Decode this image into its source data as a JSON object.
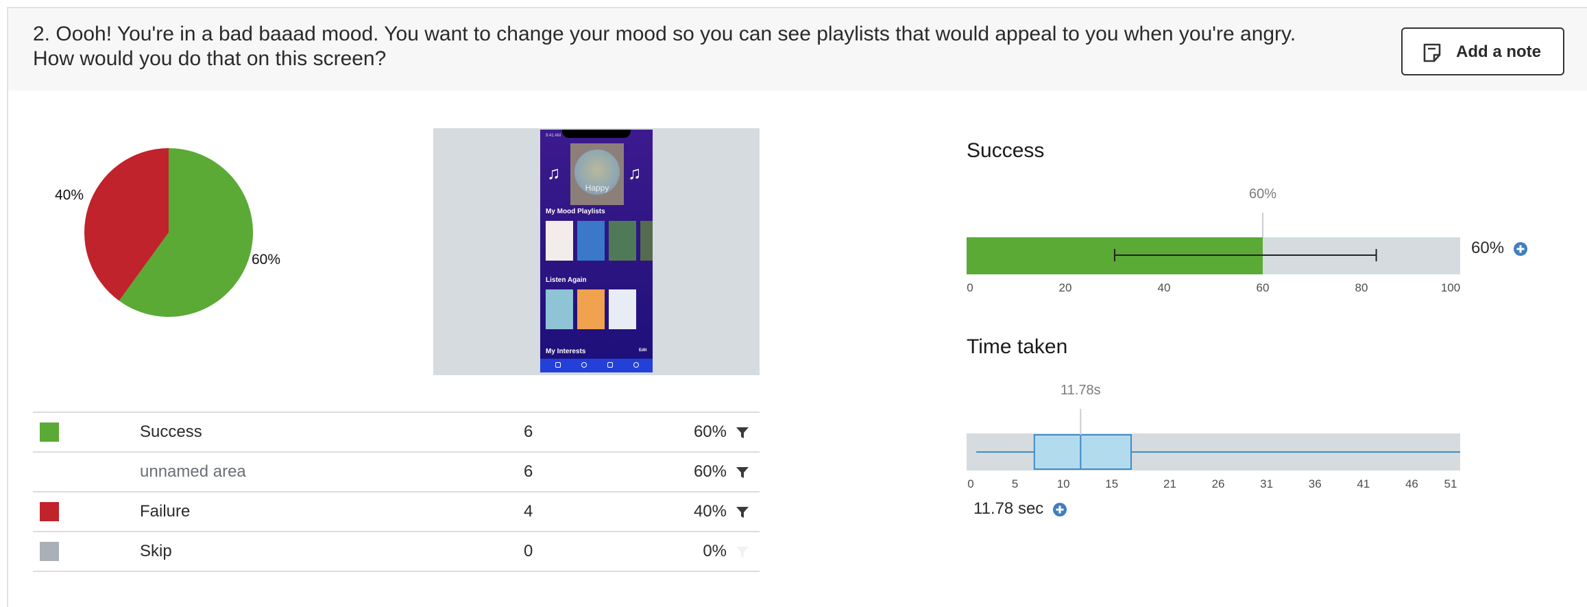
{
  "question": {
    "line1": "2. Oooh! You're in a bad baaad mood. You want to change your mood so you can see playlists that would appeal to you when you're angry.",
    "line2": "How would you do that on this screen?"
  },
  "add_note_label": "Add a note",
  "pie": {
    "slices": [
      {
        "label": "Success",
        "value": 60,
        "color": "#5aaa35",
        "text": "60%"
      },
      {
        "label": "Failure",
        "value": 40,
        "color": "#c0232c",
        "text": "40%"
      }
    ]
  },
  "screenshot": {
    "status_time": "9:41 AM",
    "mood_label": "Happy",
    "section1": "My Mood Playlists",
    "section2": "Listen Again",
    "section3": "My Interests",
    "section3_link": "Edit"
  },
  "results_table": {
    "rows": [
      {
        "label": "Success",
        "count": "6",
        "percent": "60%",
        "swatch": "#5aaa35",
        "filter": true,
        "muted": false
      },
      {
        "label": "unnamed area",
        "count": "6",
        "percent": "60%",
        "swatch": "",
        "filter": true,
        "muted": true
      },
      {
        "label": "Failure",
        "count": "4",
        "percent": "40%",
        "swatch": "#c0232c",
        "filter": true,
        "muted": false
      },
      {
        "label": "Skip",
        "count": "0",
        "percent": "0%",
        "swatch": "#a9b0b8",
        "filter": false,
        "muted": false
      }
    ]
  },
  "success_chart": {
    "title": "Success",
    "value_label": "60%",
    "side_label": "60%",
    "chart_data": {
      "type": "bar",
      "value": 60,
      "error_low": 30,
      "error_high": 83,
      "xlim": [
        0,
        100
      ],
      "ticks": [
        0,
        20,
        40,
        60,
        80,
        100
      ],
      "bar_color": "#5aaa35",
      "track_color": "#d5dbde"
    }
  },
  "time_chart": {
    "title": "Time taken",
    "median_label": "11.78s",
    "side_label": "11.78 sec",
    "chart_data": {
      "type": "boxplot",
      "median": 11.78,
      "q1": 7,
      "q3": 17,
      "whisker_low": 1,
      "whisker_high": 51,
      "xlim": [
        0,
        51
      ],
      "ticks": [
        "0",
        "5",
        "10",
        "15",
        "21",
        "26",
        "31",
        "36",
        "41",
        "46",
        "51"
      ],
      "box_color": "#b3dbee",
      "line_color": "#3d8cc6",
      "track_color": "#d5dbde"
    }
  },
  "colors": {
    "accent_blue": "#3f7fc0"
  }
}
